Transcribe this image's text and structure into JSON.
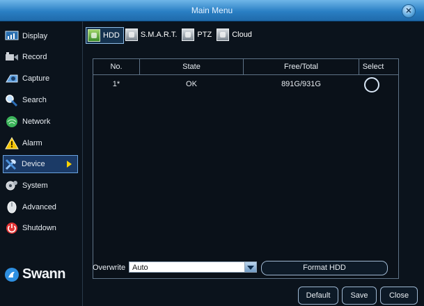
{
  "window": {
    "title": "Main Menu"
  },
  "sidebar": {
    "items": [
      {
        "label": "Display",
        "icon": "display-icon"
      },
      {
        "label": "Record",
        "icon": "record-icon"
      },
      {
        "label": "Capture",
        "icon": "capture-icon"
      },
      {
        "label": "Search",
        "icon": "search-icon"
      },
      {
        "label": "Network",
        "icon": "network-icon"
      },
      {
        "label": "Alarm",
        "icon": "alarm-icon"
      },
      {
        "label": "Device",
        "icon": "device-icon",
        "active": true
      },
      {
        "label": "System",
        "icon": "system-icon"
      },
      {
        "label": "Advanced",
        "icon": "advanced-icon"
      },
      {
        "label": "Shutdown",
        "icon": "shutdown-icon"
      }
    ],
    "logo": "Swann"
  },
  "tabs": [
    {
      "label": "HDD",
      "active": true
    },
    {
      "label": "S.M.A.R.T."
    },
    {
      "label": "PTZ"
    },
    {
      "label": "Cloud"
    }
  ],
  "table": {
    "headers": [
      "No.",
      "State",
      "Free/Total",
      "Select"
    ],
    "rows": [
      {
        "no": "1*",
        "state": "OK",
        "free_total": "891G/931G"
      }
    ]
  },
  "overwrite": {
    "label": "Overwrite",
    "value": "Auto"
  },
  "buttons": {
    "format": "Format HDD",
    "default": "Default",
    "save": "Save",
    "close": "Close"
  },
  "colors": {
    "accent": "#2a7fc4",
    "active_bg": "#1b3a66",
    "active_arrow": "#ffd400"
  }
}
